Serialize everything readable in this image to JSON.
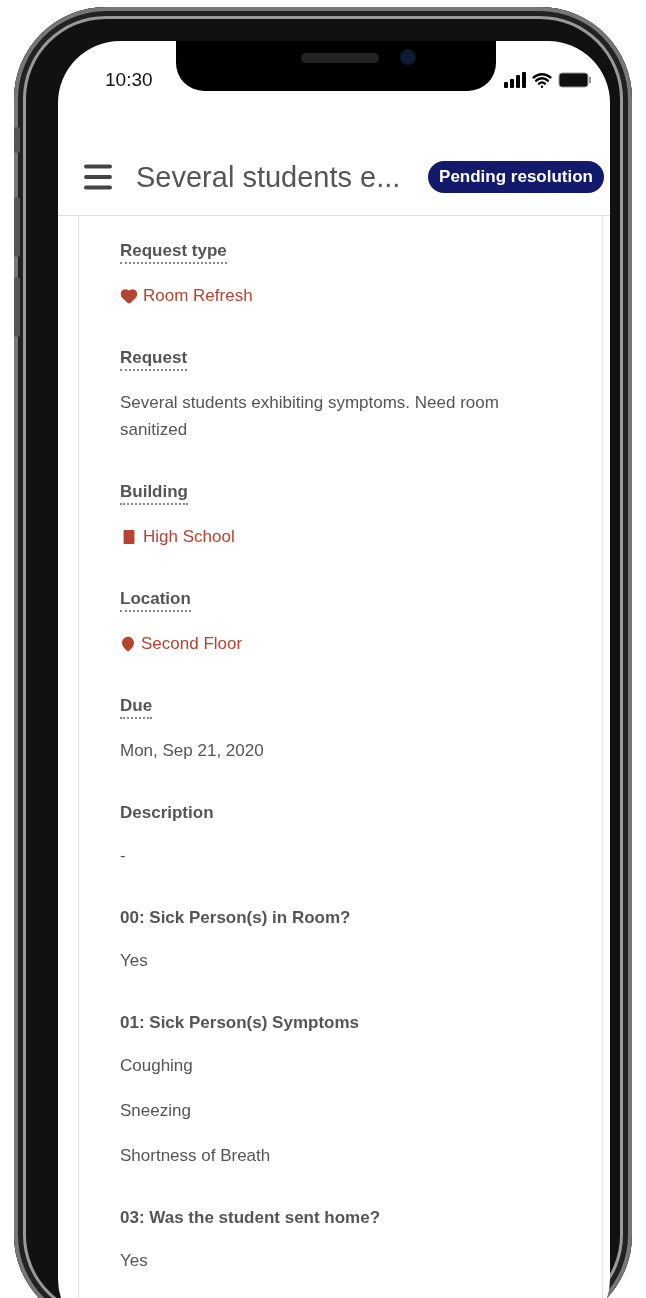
{
  "status_bar": {
    "time": "10:30"
  },
  "header": {
    "title": "Several students e...",
    "badge": "Pending resolution"
  },
  "fields": [
    {
      "label": "Request type",
      "dotted": true,
      "values": [
        {
          "text": "Room Refresh",
          "kind": "heart"
        }
      ]
    },
    {
      "label": "Request",
      "dotted": true,
      "values": [
        {
          "text": "Several students exhibiting symptoms. Need room sanitized",
          "kind": "plain"
        }
      ]
    },
    {
      "label": "Building",
      "dotted": true,
      "values": [
        {
          "text": "High School",
          "kind": "building"
        }
      ]
    },
    {
      "label": "Location",
      "dotted": true,
      "values": [
        {
          "text": "Second Floor",
          "kind": "pin"
        }
      ]
    },
    {
      "label": "Due",
      "dotted": true,
      "values": [
        {
          "text": "Mon, Sep 21, 2020",
          "kind": "plain"
        }
      ]
    },
    {
      "label": "Description",
      "dotted": false,
      "values": [
        {
          "text": "-",
          "kind": "plain"
        }
      ]
    },
    {
      "label": "00: Sick Person(s) in Room?",
      "dotted": false,
      "values": [
        {
          "text": "Yes",
          "kind": "plain"
        }
      ]
    },
    {
      "label": "01: Sick Person(s) Symptoms",
      "dotted": false,
      "values": [
        {
          "text": "Coughing",
          "kind": "plain"
        },
        {
          "text": "Sneezing",
          "kind": "plain"
        },
        {
          "text": "Shortness of Breath",
          "kind": "plain"
        }
      ]
    },
    {
      "label": "03: Was the student sent home?",
      "dotted": false,
      "values": [
        {
          "text": "Yes",
          "kind": "plain"
        }
      ]
    }
  ]
}
